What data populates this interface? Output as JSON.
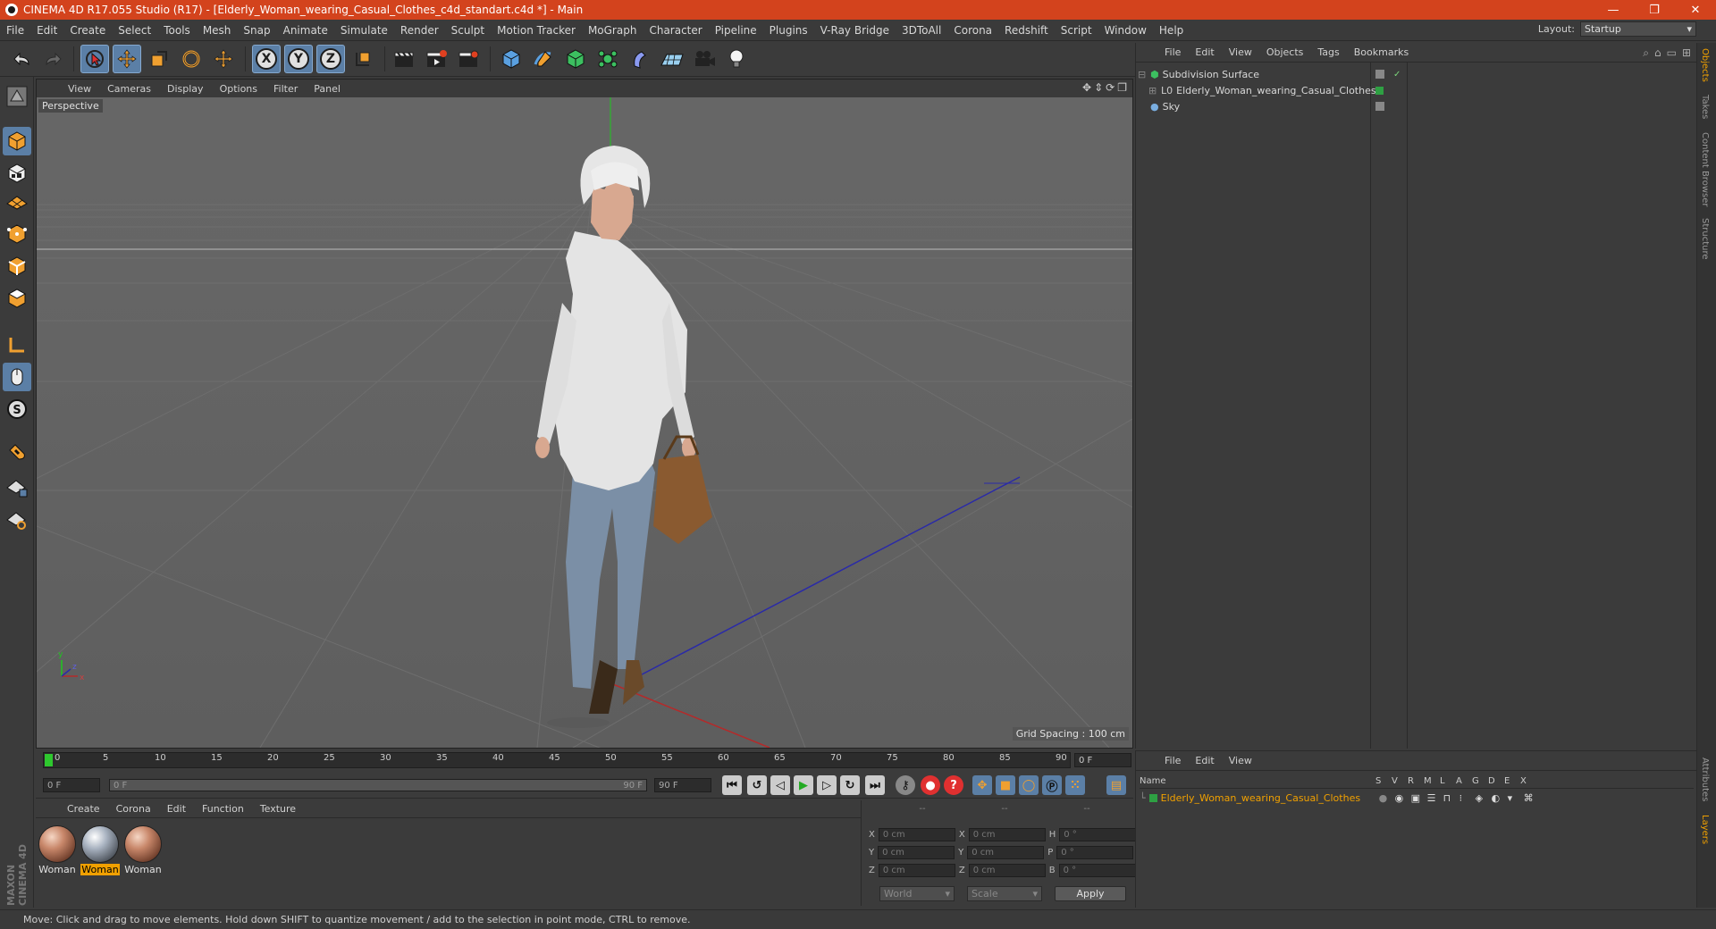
{
  "window": {
    "title": "CINEMA 4D R17.055 Studio (R17) - [Elderly_Woman_wearing_Casual_Clothes_c4d_standart.c4d *] - Main",
    "minimize": "—",
    "restore": "❐",
    "close": "✕"
  },
  "menubar": {
    "items": [
      "File",
      "Edit",
      "Create",
      "Select",
      "Tools",
      "Mesh",
      "Snap",
      "Animate",
      "Simulate",
      "Render",
      "Sculpt",
      "Motion Tracker",
      "MoGraph",
      "Character",
      "Pipeline",
      "Plugins",
      "V-Ray Bridge",
      "3DToAll",
      "Corona",
      "Redshift",
      "Script",
      "Window",
      "Help"
    ]
  },
  "layout": {
    "label": "Layout:",
    "value": "Startup"
  },
  "toolbar": {
    "axis_x": "X",
    "axis_y": "Y",
    "axis_z": "Z"
  },
  "viewport": {
    "menu": [
      "View",
      "Cameras",
      "Display",
      "Options",
      "Filter",
      "Panel"
    ],
    "camera_label": "Perspective",
    "grid_spacing": "Grid Spacing : 100 cm",
    "axes": {
      "x": "x",
      "y": "y",
      "z": "z"
    }
  },
  "timeline": {
    "ticks": [
      "0",
      "5",
      "10",
      "15",
      "20",
      "25",
      "30",
      "35",
      "40",
      "45",
      "50",
      "55",
      "60",
      "65",
      "70",
      "75",
      "80",
      "85",
      "90"
    ],
    "current_frame": "0 F"
  },
  "transport": {
    "start_field": "0 F",
    "range_start": "0 F",
    "range_end": "90 F",
    "end_field": "90 F"
  },
  "material_manager": {
    "menu": [
      "Create",
      "Corona",
      "Edit",
      "Function",
      "Texture"
    ],
    "materials": [
      {
        "name": "Woman",
        "active": false
      },
      {
        "name": "Woman",
        "active": true
      },
      {
        "name": "Woman",
        "active": false
      }
    ]
  },
  "coordinates": {
    "headers": [
      "--",
      "--",
      "--"
    ],
    "rows": [
      {
        "a": "X",
        "av": "0 cm",
        "b": "X",
        "bv": "0 cm",
        "c": "H",
        "cv": "0 °"
      },
      {
        "a": "Y",
        "av": "0 cm",
        "b": "Y",
        "bv": "0 cm",
        "c": "P",
        "cv": "0 °"
      },
      {
        "a": "Z",
        "av": "0 cm",
        "b": "Z",
        "bv": "0 cm",
        "c": "B",
        "cv": "0 °"
      }
    ],
    "mode1": "World",
    "mode2": "Scale",
    "apply": "Apply"
  },
  "object_manager": {
    "menu": [
      "File",
      "Edit",
      "View",
      "Objects",
      "Tags",
      "Bookmarks"
    ],
    "objects": [
      {
        "name": "Subdivision Surface"
      },
      {
        "name": "Elderly_Woman_wearing_Casual_Clothes"
      },
      {
        "name": "Sky"
      }
    ]
  },
  "layer_manager": {
    "menu": [
      "File",
      "Edit",
      "View"
    ],
    "columns": [
      "Name",
      "S",
      "V",
      "R",
      "M",
      "L",
      "A",
      "G",
      "D",
      "E",
      "X"
    ],
    "layer_name": "Elderly_Woman_wearing_Casual_Clothes"
  },
  "right_tabs": [
    "Objects",
    "Takes",
    "Content Browser",
    "Structure",
    "Attributes",
    "Layers"
  ],
  "logo": {
    "text": "MAXON CINEMA 4D"
  },
  "status": {
    "text": "Move: Click and drag to move elements. Hold down SHIFT to quantize movement / add to the selection in point mode, CTRL to remove."
  },
  "colors": {
    "title_bar": "#d3431d",
    "selection": "#5b7fa6",
    "active_material": "#f0a000",
    "layer_name": "#f0a000"
  }
}
